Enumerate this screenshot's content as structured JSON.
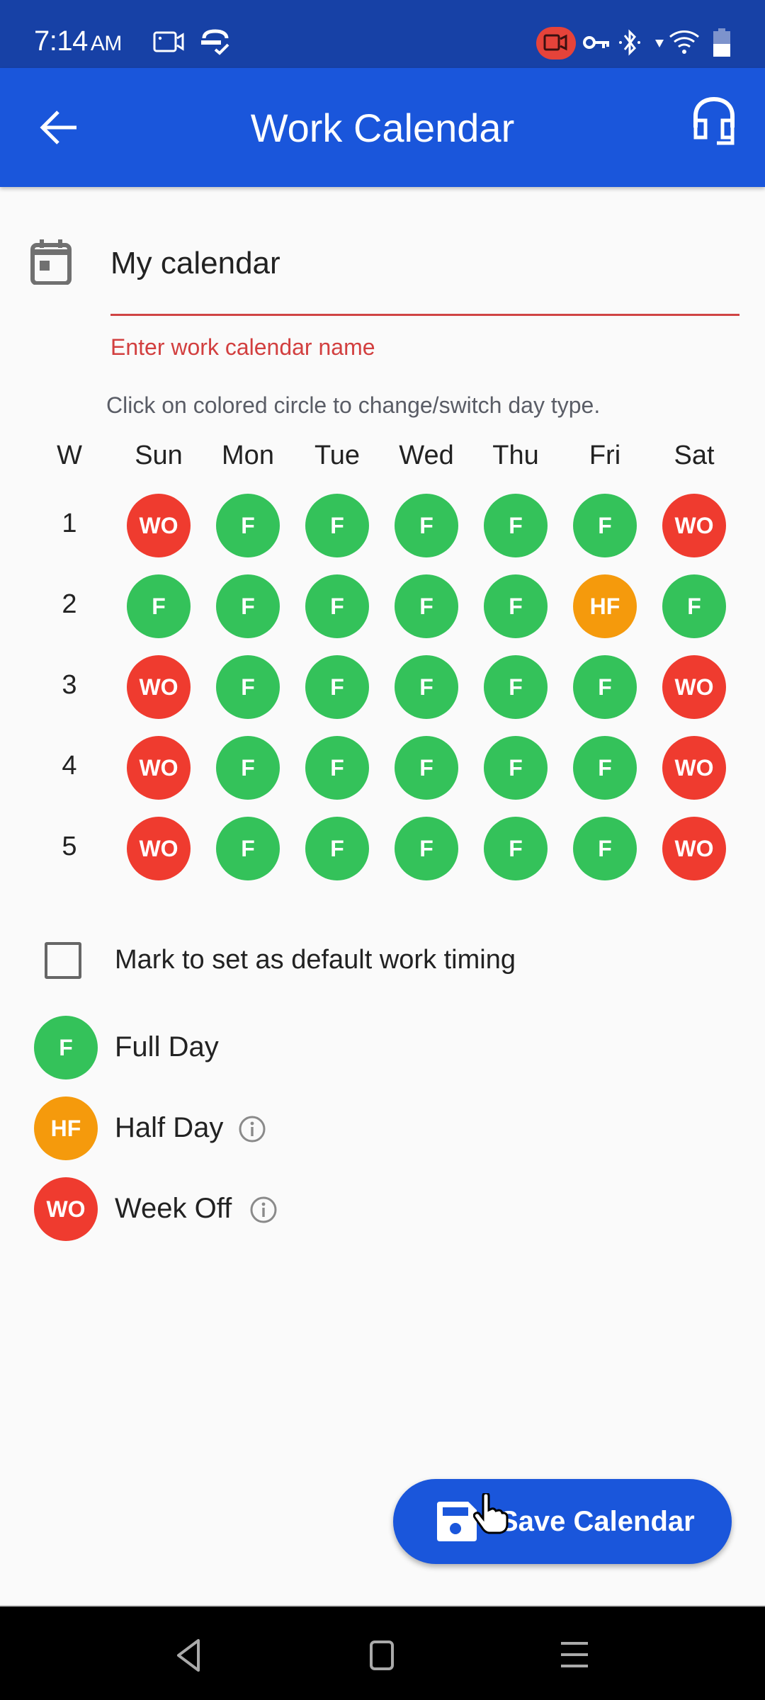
{
  "status_bar": {
    "time": "7:14",
    "ampm": "AM",
    "icons": [
      "screen-record-icon",
      "sync-check-icon",
      "recording-active-icon",
      "vpn-key-icon",
      "bluetooth-icon",
      "wifi-icon",
      "battery-icon"
    ]
  },
  "app_bar": {
    "title": "Work Calendar",
    "back_icon": "arrow-left-icon",
    "support_icon": "headset-icon"
  },
  "form": {
    "calendar_icon": "calendar-icon",
    "name_value": "My calendar",
    "error": "Enter work calendar name",
    "hint": "Click on colored circle to change/switch day type."
  },
  "calendar": {
    "week_header": "W",
    "days": [
      "Sun",
      "Mon",
      "Tue",
      "Wed",
      "Thu",
      "Fri",
      "Sat"
    ],
    "weeks": [
      {
        "week": "1",
        "cells": [
          "WO",
          "F",
          "F",
          "F",
          "F",
          "F",
          "WO"
        ]
      },
      {
        "week": "2",
        "cells": [
          "F",
          "F",
          "F",
          "F",
          "F",
          "HF",
          "F"
        ]
      },
      {
        "week": "3",
        "cells": [
          "WO",
          "F",
          "F",
          "F",
          "F",
          "F",
          "WO"
        ]
      },
      {
        "week": "4",
        "cells": [
          "WO",
          "F",
          "F",
          "F",
          "F",
          "F",
          "WO"
        ]
      },
      {
        "week": "5",
        "cells": [
          "WO",
          "F",
          "F",
          "F",
          "F",
          "F",
          "WO"
        ]
      }
    ]
  },
  "default_timing": {
    "label": "Mark to set as default work timing",
    "checked": false
  },
  "legend": [
    {
      "code": "F",
      "label": "Full Day",
      "info": false
    },
    {
      "code": "HF",
      "label": "Half Day",
      "info": true
    },
    {
      "code": "WO",
      "label": "Week Off",
      "info": true
    }
  ],
  "colors": {
    "F": "#34c25a",
    "HF": "#f59a0c",
    "WO": "#ef3b2f",
    "primary": "#1a56db",
    "status_bar": "#1741a6",
    "error": "#d23f3f"
  },
  "save_button": {
    "label": "Save Calendar",
    "icon": "floppy-disk-icon"
  },
  "nav_bar": {
    "buttons": [
      "back-triangle-icon",
      "home-square-icon",
      "recents-menu-icon"
    ]
  }
}
